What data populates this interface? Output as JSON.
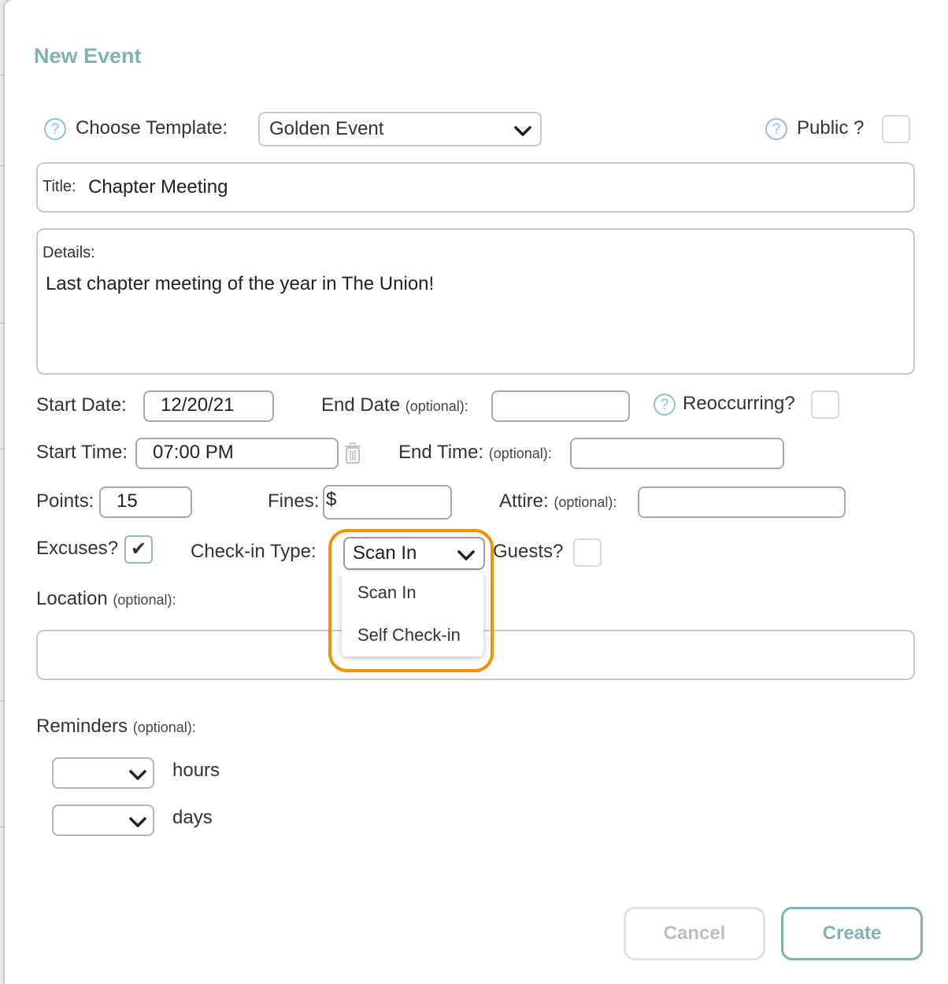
{
  "form": {
    "title": "New Event",
    "template": {
      "label": "Choose Template:",
      "value": "Golden Event"
    },
    "public": {
      "label": "Public ?"
    },
    "title_field": {
      "label": "Title:",
      "value": "Chapter Meeting"
    },
    "details": {
      "label": "Details:",
      "value": "Last chapter meeting of the year in The Union!"
    },
    "start_date": {
      "label": "Start Date:",
      "value": "12/20/21"
    },
    "end_date": {
      "label": "End Date",
      "optional": "(optional):",
      "value": ""
    },
    "reoccurring": {
      "label": "Reoccurring?"
    },
    "start_time": {
      "label": "Start Time:",
      "value": "07:00 PM"
    },
    "end_time": {
      "label": "End Time:",
      "optional": "(optional):",
      "value": ""
    },
    "points": {
      "label": "Points:",
      "value": "15"
    },
    "fines": {
      "label": "Fines:",
      "value": "$"
    },
    "attire": {
      "label": "Attire:",
      "optional": "(optional):",
      "value": ""
    },
    "excuses": {
      "label": "Excuses?",
      "checked": true,
      "check_glyph": "✔"
    },
    "checkin": {
      "label": "Check-in Type:",
      "value": "Scan In",
      "options": [
        "Scan In",
        "Self Check-in"
      ],
      "highlight_color": "#f39200"
    },
    "guests": {
      "label": "Guests?"
    },
    "location": {
      "label": "Location",
      "optional": "(optional):",
      "value": ""
    },
    "reminders": {
      "label": "Reminders",
      "optional": "(optional):",
      "hours_label": "hours",
      "days_label": "days"
    }
  },
  "buttons": {
    "cancel": "Cancel",
    "create": "Create"
  },
  "colors": {
    "accent": "#7fb3ad",
    "help": "#8ec1d6",
    "highlight": "#f39200"
  }
}
